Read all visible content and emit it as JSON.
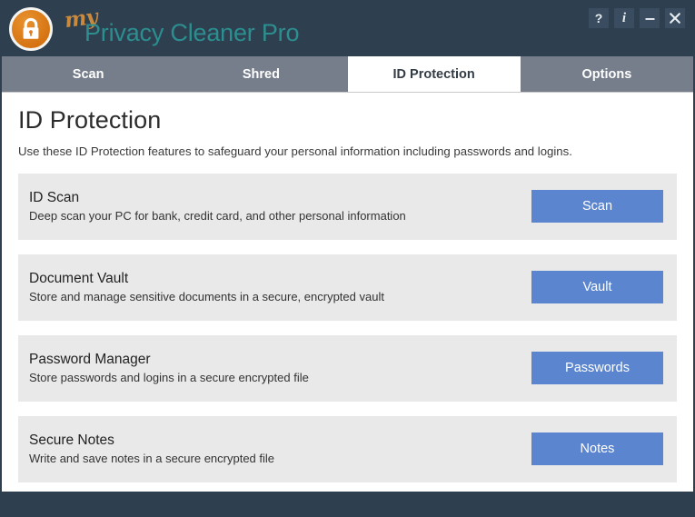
{
  "titlebar": {
    "brand_my": "my",
    "brand_main": "Privacy Cleaner Pro",
    "logo_icon": "padlock-icon",
    "controls": [
      {
        "name": "help-button",
        "label": "?",
        "icon": "question-mark-icon"
      },
      {
        "name": "info-button",
        "label": "i",
        "icon": "info-icon"
      },
      {
        "name": "minimize-button",
        "label": "—",
        "icon": "minimize-icon"
      },
      {
        "name": "close-button",
        "label": "✕",
        "icon": "close-icon"
      }
    ]
  },
  "tabs": [
    {
      "label": "Scan",
      "active": false
    },
    {
      "label": "Shred",
      "active": false
    },
    {
      "label": "ID Protection",
      "active": true
    },
    {
      "label": "Options",
      "active": false
    }
  ],
  "page": {
    "title": "ID Protection",
    "subtitle": "Use these ID Protection features to safeguard your personal information including passwords and logins."
  },
  "features": [
    {
      "title": "ID Scan",
      "description": "Deep scan your PC for bank, credit card, and other personal information",
      "button_label": "Scan"
    },
    {
      "title": "Document Vault",
      "description": "Store and manage sensitive documents in a secure, encrypted vault",
      "button_label": "Vault"
    },
    {
      "title": "Password Manager",
      "description": "Store passwords and logins in a secure encrypted file",
      "button_label": "Passwords"
    },
    {
      "title": "Secure Notes",
      "description": "Write and save notes in a secure encrypted file",
      "button_label": "Notes"
    }
  ],
  "colors": {
    "header_bg": "#2e3f50",
    "tab_inactive_bg": "#767e8c",
    "tab_active_bg": "#ffffff",
    "brand_accent": "#2c8e8e",
    "brand_my_accent": "#c98a3d",
    "logo_orange": "#e07b1f",
    "button_blue": "#5b86cf",
    "card_bg": "#e9e9e9"
  }
}
